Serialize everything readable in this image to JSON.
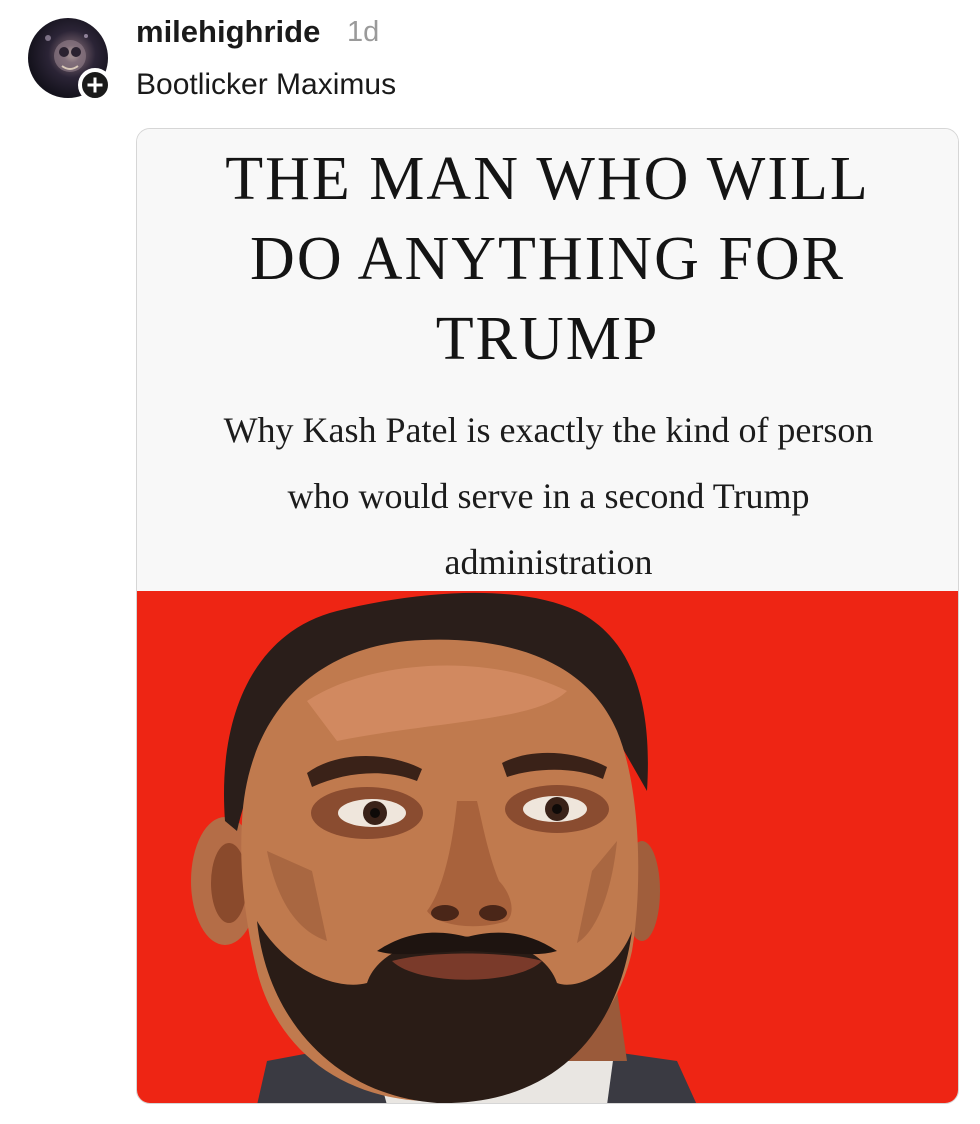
{
  "post": {
    "username": "milehighride",
    "timestamp": "1d",
    "text": "Bootlicker Maximus"
  },
  "avatar": {
    "icon": "avatar-image",
    "follow_icon": "plus-icon"
  },
  "article": {
    "headline": "THE MAN WHO WILL\nDO ANYTHING FOR\nTRUMP",
    "subheadline": "Why Kash Patel is exactly the kind of person\nwho would serve in a second Trump\nadministration",
    "illustration_background": "#ee2514"
  }
}
